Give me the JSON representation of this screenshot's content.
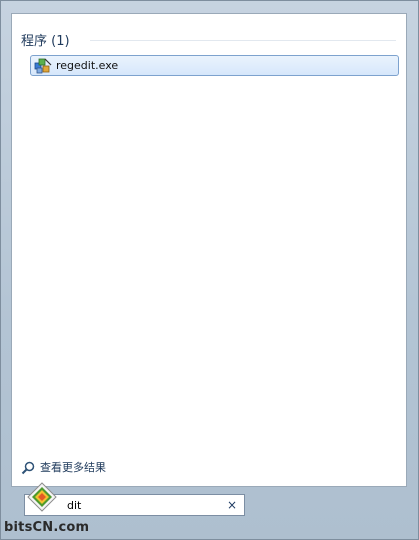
{
  "start_menu": {
    "results": {
      "group_header": "程序 (1)",
      "items": [
        {
          "label": "regedit.exe",
          "icon": "regedit-icon"
        }
      ]
    },
    "see_more": {
      "label": "查看更多结果",
      "icon": "search-icon"
    },
    "search_box": {
      "value": "dit",
      "clear_icon": "×"
    }
  },
  "watermark": {
    "text": "bitsCN.com",
    "logo": "bitscn-logo"
  },
  "colors": {
    "frame": "#b8c8d8",
    "header_text": "#1e395b",
    "selection_border": "#7da2ce",
    "selection_fill": "#dbe9fb"
  }
}
